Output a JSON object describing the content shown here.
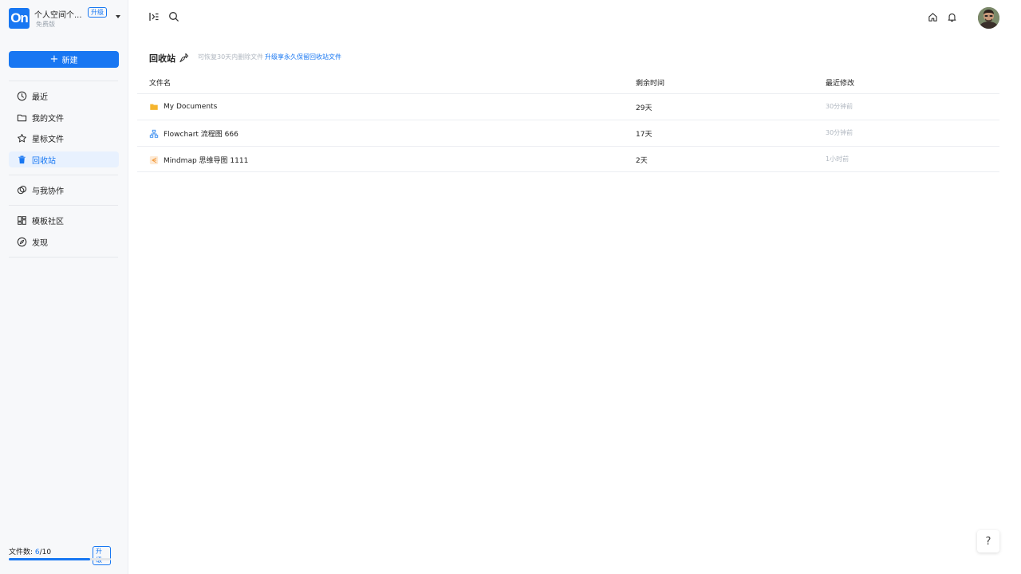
{
  "workspace": {
    "logo": "On",
    "name": "个人空间个...",
    "badge": "升级",
    "plan": "免费版"
  },
  "sidebar": {
    "new_label": "新建",
    "items": [
      {
        "label": "最近",
        "icon": "clock-icon"
      },
      {
        "label": "我的文件",
        "icon": "folder-icon"
      },
      {
        "label": "星标文件",
        "icon": "star-icon"
      },
      {
        "label": "回收站",
        "icon": "trash-icon",
        "active": true
      },
      {
        "label": "与我协作",
        "icon": "collaborate-icon"
      },
      {
        "label": "模板社区",
        "icon": "template-icon"
      },
      {
        "label": "发现",
        "icon": "compass-icon"
      }
    ],
    "usage": {
      "label": "文件数: ",
      "current": "6",
      "total": "/10",
      "badge": "升级",
      "fraction": 0.8
    }
  },
  "topbar": {
    "icons": [
      "sidebar-toggle-icon",
      "search-icon",
      "home-icon",
      "bell-icon"
    ]
  },
  "page": {
    "title": "回收站",
    "hint": "可恢复30天内删除文件",
    "hint_link": "升级享永久保留回收站文件"
  },
  "table": {
    "headers": {
      "name": "文件名",
      "remaining": "剩余时间",
      "modified": "最近修改"
    },
    "rows": [
      {
        "name": "My Documents",
        "icon": "folder-icon",
        "remaining": "29天",
        "modified": "30分钟前"
      },
      {
        "name": "Flowchart 流程图  666",
        "icon": "flowchart-icon",
        "remaining": "17天",
        "modified": "30分钟前"
      },
      {
        "name": "Mindmap 思维导图  1111",
        "icon": "mindmap-icon",
        "remaining": "2天",
        "modified": "1小时前"
      }
    ]
  },
  "help": {
    "label": "?"
  },
  "colors": {
    "accent": "#1877f2",
    "folder": "#f5b52e",
    "mindmap": "#f39a3b"
  }
}
